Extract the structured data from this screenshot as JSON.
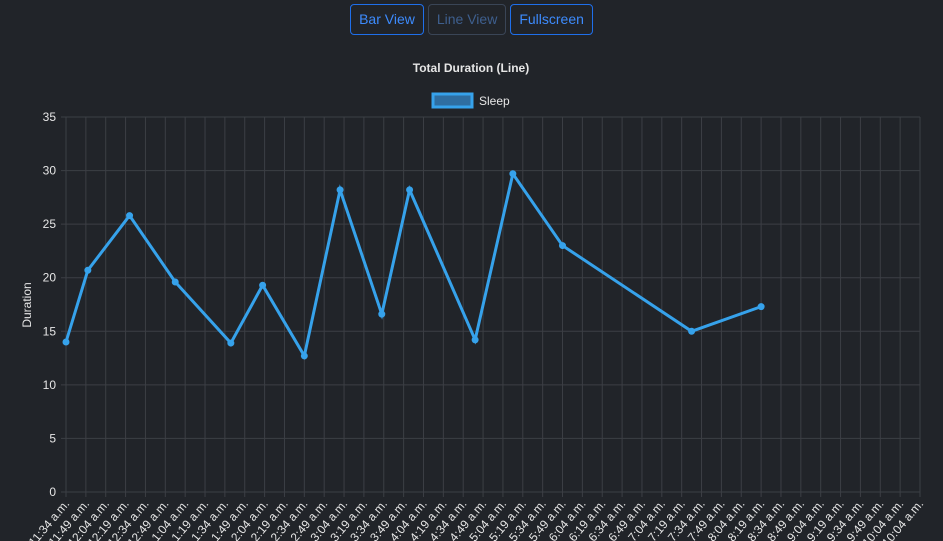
{
  "toolbar": {
    "bar_label": "Bar View",
    "line_label": "Line View",
    "fullscreen_label": "Fullscreen"
  },
  "colors": {
    "background": "#212429",
    "series": "#36a2eb",
    "grid": "#3c3f45",
    "text": "#e6e6e6",
    "button": "#3d8bfd"
  },
  "chart_data": {
    "type": "line",
    "title": "Total Duration (Line)",
    "xlabel": "",
    "ylabel": "Duration",
    "ylim": [
      0,
      35
    ],
    "yticks": [
      "0",
      "5",
      "10",
      "15",
      "20",
      "25",
      "30",
      "35"
    ],
    "grid": true,
    "legend": "top-center",
    "categories": [
      "11:34 a.m.",
      "11:49 a.m.",
      "12:04 a.m.",
      "12:19 a.m.",
      "12:34 a.m.",
      "12:49 a.m.",
      "1:04 a.m.",
      "1:19 a.m.",
      "1:34 a.m.",
      "1:49 a.m.",
      "2:04 a.m.",
      "2:19 a.m.",
      "2:34 a.m.",
      "2:49 a.m.",
      "3:04 a.m.",
      "3:19 a.m.",
      "3:34 a.m.",
      "3:49 a.m.",
      "4:04 a.m.",
      "4:19 a.m.",
      "4:34 a.m.",
      "4:49 a.m.",
      "5:04 a.m.",
      "5:19 a.m.",
      "5:34 a.m.",
      "5:49 a.m.",
      "6:04 a.m.",
      "6:19 a.m.",
      "6:34 a.m.",
      "6:49 a.m.",
      "7:04 a.m.",
      "7:19 a.m.",
      "7:34 a.m.",
      "7:49 a.m.",
      "8:04 a.m.",
      "8:19 a.m.",
      "8:34 a.m.",
      "8:49 a.m.",
      "9:04 a.m.",
      "9:19 a.m.",
      "9:34 a.m.",
      "9:49 a.m.",
      "10:04 a.m.",
      "10:04 a.m."
    ],
    "series": [
      {
        "name": "Sleep",
        "points": [
          {
            "i": 0,
            "y": 14.0
          },
          {
            "i": 1.1,
            "y": 20.7
          },
          {
            "i": 3.2,
            "y": 25.8
          },
          {
            "i": 5.5,
            "y": 19.6
          },
          {
            "i": 8.3,
            "y": 13.9
          },
          {
            "i": 9.9,
            "y": 19.3
          },
          {
            "i": 12.0,
            "y": 12.7
          },
          {
            "i": 13.8,
            "y": 28.2
          },
          {
            "i": 15.9,
            "y": 16.6
          },
          {
            "i": 17.3,
            "y": 28.2
          },
          {
            "i": 20.6,
            "y": 14.2
          },
          {
            "i": 22.5,
            "y": 29.7
          },
          {
            "i": 25.0,
            "y": 23.0
          },
          {
            "i": 31.5,
            "y": 15.0
          },
          {
            "i": 35.0,
            "y": 17.3
          }
        ]
      }
    ]
  }
}
